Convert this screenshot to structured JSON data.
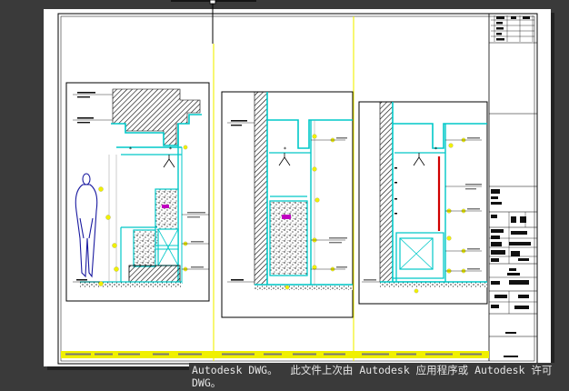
{
  "watermark": {
    "text": "Autodesk DWG。  此文件上次由 Autodesk 应用程序或 Autodesk 许可DWG。"
  },
  "colors": {
    "background": "#3a3a3a",
    "paper": "#ffffff",
    "cyan": "#00c8c8",
    "yellow": "#f0f000",
    "blue_figure": "#1a1aa0",
    "magenta": "#c000c0",
    "red": "#d00000",
    "black": "#000000"
  },
  "icons": [
    "human-figure",
    "ceiling-lamp",
    "tiled-wall",
    "tile-cross"
  ]
}
